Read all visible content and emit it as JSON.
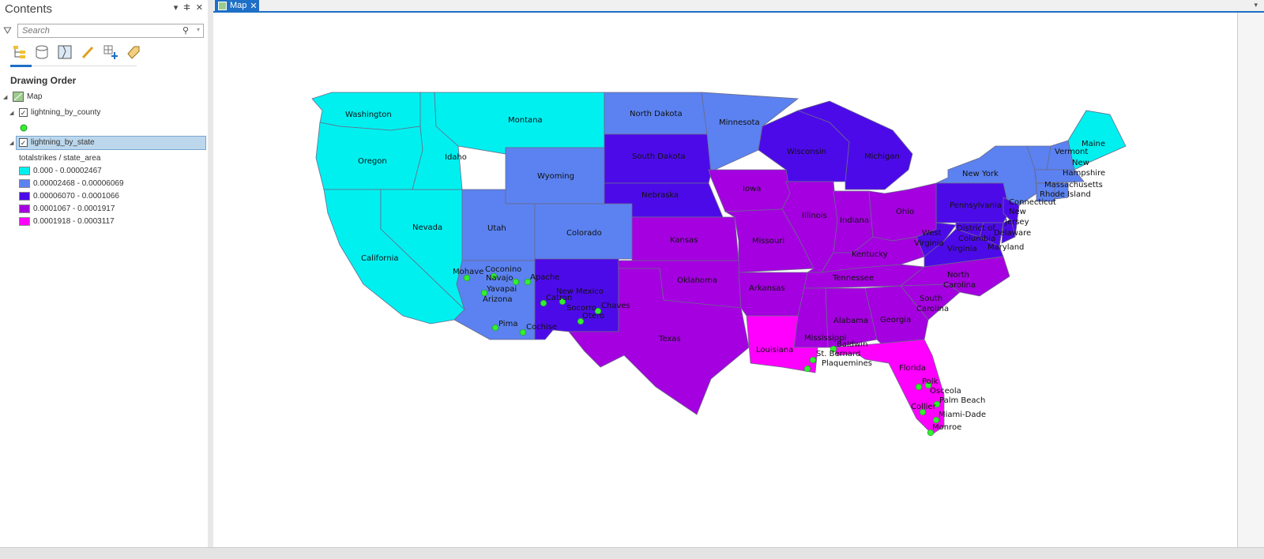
{
  "contents": {
    "title": "Contents",
    "search_placeholder": "Search",
    "drawing_order": "Drawing Order",
    "map_item": "Map",
    "layer_county": "lightning_by_county",
    "layer_state": "lightning_by_state",
    "field_label": "totalstrikes / state_area",
    "legend": [
      {
        "label": "0.000 - 0.00002467",
        "color": "#00f0f0"
      },
      {
        "label": "0.00002468 - 0.00006069",
        "color": "#5b82f0"
      },
      {
        "label": "0.00006070 - 0.0001066",
        "color": "#4d0ae8"
      },
      {
        "label": "0.0001067 - 0.0001917",
        "color": "#a400e0"
      },
      {
        "label": "0.0001918 - 0.0003117",
        "color": "#ff00ff"
      }
    ],
    "county_symbol_color": "#33ee33",
    "tools": [
      "list-by-drawing-order-icon",
      "list-by-source-icon",
      "list-by-selection-icon",
      "list-by-editing-icon",
      "list-by-snapping-icon",
      "list-by-labeling-icon"
    ]
  },
  "tab": {
    "label": "Map"
  },
  "map": {
    "states": [
      {
        "name": "Washington",
        "cls": 0
      },
      {
        "name": "Oregon",
        "cls": 0
      },
      {
        "name": "California",
        "cls": 0
      },
      {
        "name": "Nevada",
        "cls": 0
      },
      {
        "name": "Idaho",
        "cls": 0
      },
      {
        "name": "Montana",
        "cls": 0
      },
      {
        "name": "Maine",
        "cls": 0
      },
      {
        "name": "North Dakota",
        "cls": 1
      },
      {
        "name": "Minnesota",
        "cls": 1
      },
      {
        "name": "Wyoming",
        "cls": 1
      },
      {
        "name": "Utah",
        "cls": 1
      },
      {
        "name": "Colorado",
        "cls": 1
      },
      {
        "name": "Arizona",
        "cls": 1
      },
      {
        "name": "New York",
        "cls": 1
      },
      {
        "name": "Vermont",
        "cls": 1
      },
      {
        "name": "New Hampshire",
        "cls": 1
      },
      {
        "name": "Massachusetts",
        "cls": 1
      },
      {
        "name": "Rhode Island",
        "cls": 1
      },
      {
        "name": "Connecticut",
        "cls": 1
      },
      {
        "name": "South Dakota",
        "cls": 2
      },
      {
        "name": "Nebraska",
        "cls": 2
      },
      {
        "name": "Wisconsin",
        "cls": 2
      },
      {
        "name": "Michigan",
        "cls": 2
      },
      {
        "name": "New Mexico",
        "cls": 2
      },
      {
        "name": "Pennsylvania",
        "cls": 2
      },
      {
        "name": "West Virginia",
        "cls": 2
      },
      {
        "name": "Virginia",
        "cls": 2
      },
      {
        "name": "New Jersey",
        "cls": 2
      },
      {
        "name": "Delaware",
        "cls": 2
      },
      {
        "name": "District of Columbia",
        "cls": 2
      },
      {
        "name": "Maryland",
        "cls": 2
      },
      {
        "name": "Iowa",
        "cls": 3
      },
      {
        "name": "Illinois",
        "cls": 3
      },
      {
        "name": "Indiana",
        "cls": 3
      },
      {
        "name": "Ohio",
        "cls": 3
      },
      {
        "name": "Kansas",
        "cls": 3
      },
      {
        "name": "Missouri",
        "cls": 3
      },
      {
        "name": "Kentucky",
        "cls": 3
      },
      {
        "name": "Oklahoma",
        "cls": 3
      },
      {
        "name": "Arkansas",
        "cls": 3
      },
      {
        "name": "Tennessee",
        "cls": 3
      },
      {
        "name": "North Carolina",
        "cls": 3
      },
      {
        "name": "South Carolina",
        "cls": 3
      },
      {
        "name": "Georgia",
        "cls": 3
      },
      {
        "name": "Alabama",
        "cls": 3
      },
      {
        "name": "Mississippi",
        "cls": 3
      },
      {
        "name": "Texas",
        "cls": 3
      },
      {
        "name": "Louisiana",
        "cls": 4
      },
      {
        "name": "Florida",
        "cls": 4
      }
    ],
    "counties": [
      "Mohave",
      "Coconino",
      "Navajo",
      "Apache",
      "Yavapai",
      "Pima",
      "Cochise",
      "Catron",
      "Socorro",
      "Chaves",
      "Otero",
      "St. Bernard",
      "Plaquemines",
      "Baldwin",
      "Polk",
      "Osceola",
      "Palm Beach",
      "Collier",
      "Miami-Dade",
      "Monroe"
    ]
  }
}
